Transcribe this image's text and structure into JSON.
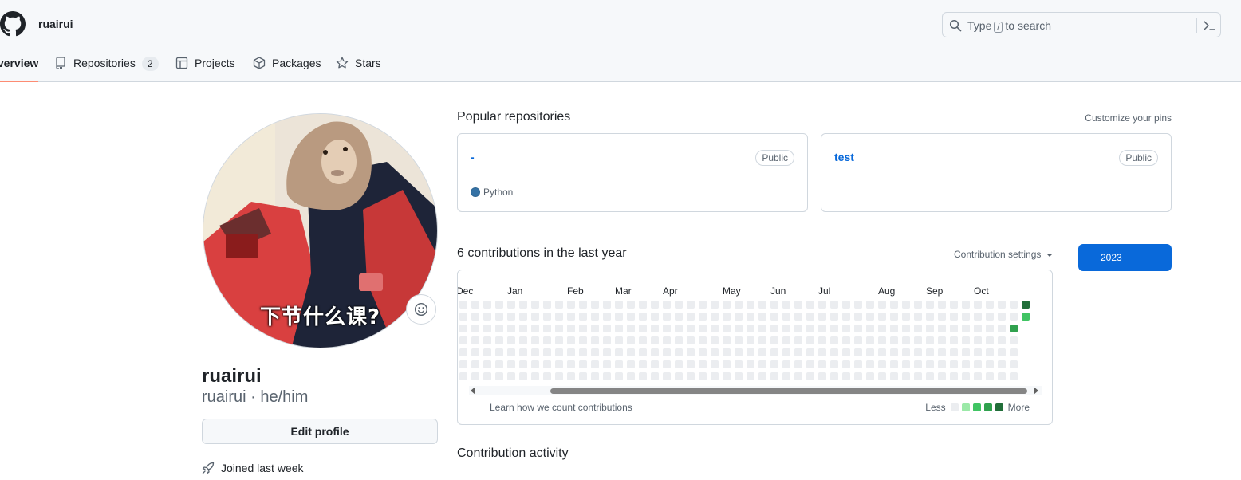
{
  "header": {
    "username": "ruairui",
    "search": {
      "prefix": "Type",
      "key": "/",
      "suffix": "to search"
    }
  },
  "tabs": [
    {
      "label": "Overview",
      "icon": "book-icon",
      "active": true
    },
    {
      "label": "Repositories",
      "icon": "repo-icon",
      "count": "2"
    },
    {
      "label": "Projects",
      "icon": "table-icon"
    },
    {
      "label": "Packages",
      "icon": "package-icon"
    },
    {
      "label": "Stars",
      "icon": "star-icon"
    }
  ],
  "profile": {
    "avatar_caption": "下节什么课?",
    "name": "ruairui",
    "login_line": "ruairui · he/him",
    "edit_button": "Edit profile",
    "joined": "Joined last week"
  },
  "popular": {
    "title": "Popular repositories",
    "customize": "Customize your pins",
    "repos": [
      {
        "name": "-",
        "visibility": "Public",
        "language": "Python",
        "language_color": "#3572A5"
      },
      {
        "name": "test",
        "visibility": "Public",
        "language": "",
        "language_color": ""
      }
    ]
  },
  "contributions": {
    "title": "6 contributions in the last year",
    "settings": "Contribution settings",
    "year": "2023",
    "months": [
      "Dec",
      "Jan",
      "Feb",
      "Mar",
      "Apr",
      "May",
      "Jun",
      "Jul",
      "Aug",
      "Sep",
      "Oct"
    ],
    "learn": "Learn how we count contributions",
    "less": "Less",
    "more": "More",
    "colors": [
      "#ebedf0",
      "#9be9a8",
      "#40c463",
      "#30a14e",
      "#216e39"
    ],
    "active_cells": [
      {
        "week": 47,
        "day": 0,
        "level": 4
      },
      {
        "week": 47,
        "day": 1,
        "level": 2
      },
      {
        "week": 46,
        "day": 2,
        "level": 3
      }
    ]
  },
  "activity": {
    "title": "Contribution activity"
  }
}
